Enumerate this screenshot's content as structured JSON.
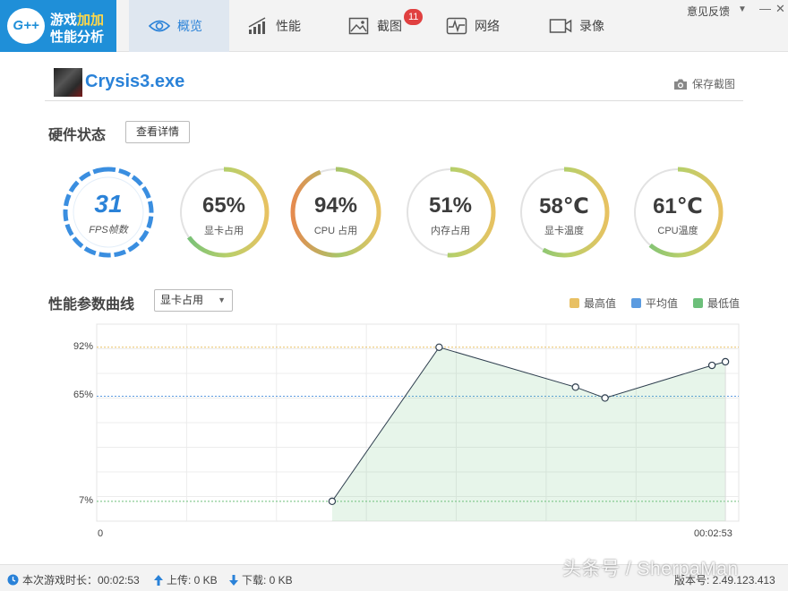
{
  "app": {
    "logo_text": "G++",
    "title_line1_a": "游戏",
    "title_line1_b": "加加",
    "title_line2": "性能分析"
  },
  "tabs": [
    {
      "label": "概览",
      "icon": "eye-icon",
      "active": true
    },
    {
      "label": "性能",
      "icon": "bar-chart-icon"
    },
    {
      "label": "截图",
      "icon": "image-icon",
      "badge": "11"
    },
    {
      "label": "网络",
      "icon": "pulse-icon"
    },
    {
      "label": "录像",
      "icon": "video-camera-icon"
    }
  ],
  "titlebar": {
    "feedback": "意见反馈",
    "dropdown_icon": "▼",
    "minimize_icon": "—",
    "close_icon": "✕"
  },
  "game": {
    "name": "Crysis3.exe",
    "save_screenshot": "保存截图"
  },
  "hardware": {
    "title": "硬件状态",
    "details_button": "查看详情",
    "fps": {
      "value": "31",
      "label": "FPS帧数"
    },
    "gauges": [
      {
        "value": "65%",
        "label": "显卡占用",
        "level": 0.65
      },
      {
        "value": "94%",
        "label": "CPU 占用",
        "level": 0.94
      },
      {
        "value": "51%",
        "label": "内存占用",
        "level": 0.51
      },
      {
        "value": "58℃",
        "label": "显卡温度",
        "level": 0.58
      },
      {
        "value": "61℃",
        "label": "CPU温度",
        "level": 0.61
      }
    ]
  },
  "curve": {
    "title": "性能参数曲线",
    "selected_metric": "显卡占用",
    "legend": [
      {
        "name": "最高值",
        "color": "#e8c063"
      },
      {
        "name": "平均值",
        "color": "#5b9be0"
      },
      {
        "name": "最低值",
        "color": "#6cbf7a"
      }
    ]
  },
  "chart_data": {
    "type": "area",
    "x_start_label": "0",
    "x_end_label": "00:02:53",
    "y_ticks": [
      "92%",
      "65%",
      "7%"
    ],
    "reference_lines": {
      "max": 92,
      "avg": 65,
      "min": 7
    },
    "ylim": [
      0,
      100
    ],
    "grid": true,
    "series": [
      {
        "x": [
          0.3667,
          0.5333,
          0.7458,
          0.7917,
          0.9583,
          0.9792
        ],
        "values": [
          7,
          92,
          70,
          64,
          82,
          84
        ]
      }
    ]
  },
  "status": {
    "session_time": "本次游戏时长：00:02:53",
    "upload": "上传: 0 KB",
    "download": "下载: 0 KB",
    "version": "版本号: 2.49.123.413"
  },
  "watermark": "头条号 / SherpaMan"
}
